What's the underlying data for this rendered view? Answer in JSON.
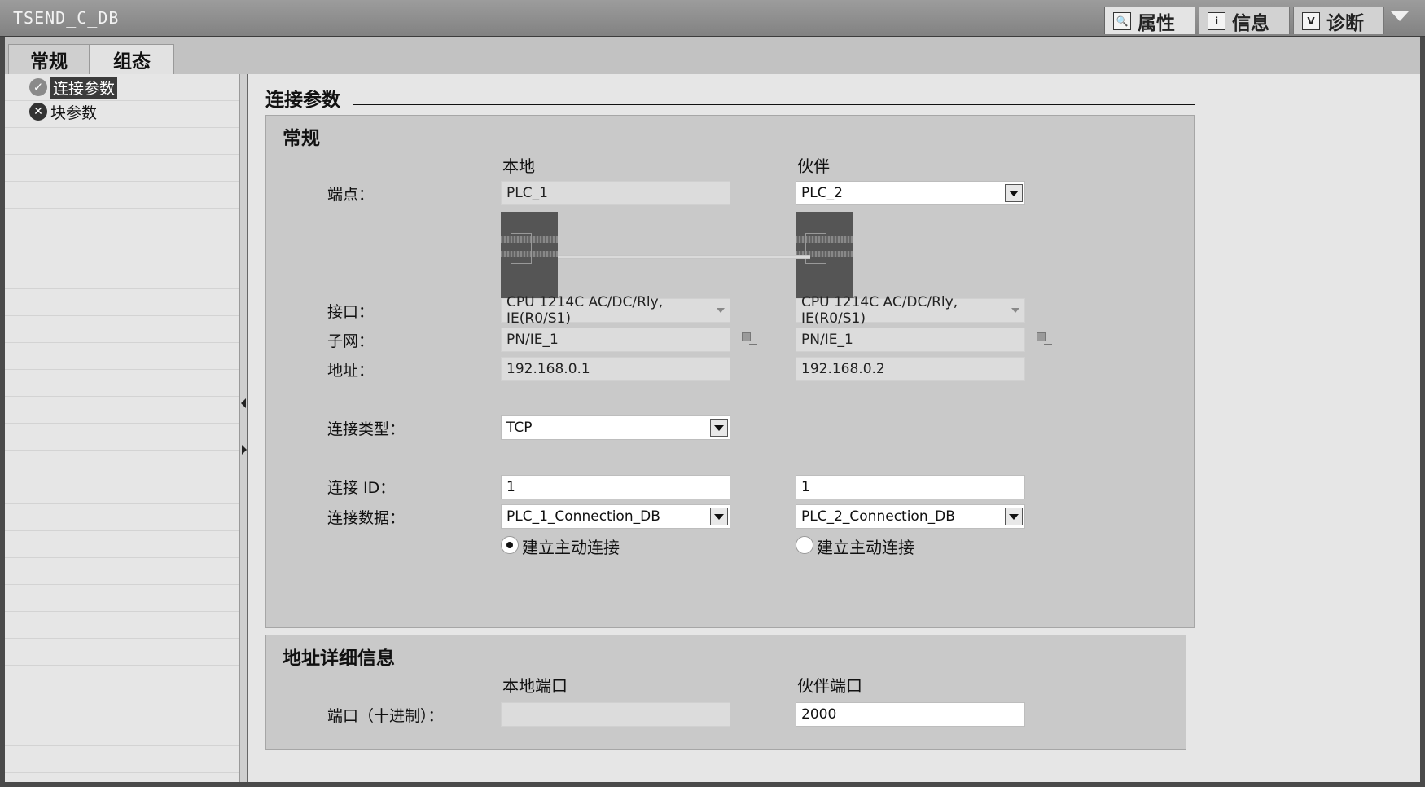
{
  "window": {
    "title": "TSEND_C_DB",
    "tabs": [
      {
        "label": "属性",
        "icon": "properties-icon"
      },
      {
        "label": "信息",
        "icon": "info-icon"
      },
      {
        "label": "诊断",
        "icon": "diagnostics-icon"
      }
    ]
  },
  "subtabs": [
    "常规",
    "组态"
  ],
  "nav": {
    "items": [
      {
        "label": "连接参数",
        "status": "ok"
      },
      {
        "label": "块参数",
        "status": "error"
      }
    ]
  },
  "section": {
    "title": "连接参数",
    "general": {
      "title": "常规",
      "col_local": "本地",
      "col_partner": "伙伴",
      "labels": {
        "endpoint": "端点：",
        "interface": "接口：",
        "subnet": "子网：",
        "address": "地址：",
        "conn_type": "连接类型：",
        "conn_id": "连接 ID：",
        "conn_data": "连接数据："
      },
      "local": {
        "endpoint": "PLC_1",
        "interface": "CPU 1214C AC/DC/Rly, IE(R0/S1)",
        "subnet": "PN/IE_1",
        "address": "192.168.0.1",
        "conn_type": "TCP",
        "conn_id": "1",
        "conn_data": "PLC_1_Connection_DB",
        "active_label": "建立主动连接",
        "active_checked": true
      },
      "partner": {
        "endpoint": "PLC_2",
        "interface": "CPU 1214C AC/DC/Rly, IE(R0/S1)",
        "subnet": "PN/IE_1",
        "address": "192.168.0.2",
        "conn_id": "1",
        "conn_data": "PLC_2_Connection_DB",
        "active_label": "建立主动连接",
        "active_checked": false
      }
    },
    "address_details": {
      "title": "地址详细信息",
      "col_local": "本地端口",
      "col_partner": "伙伴端口",
      "port_label": "端口（十进制）：",
      "local_port": "",
      "partner_port": "2000"
    }
  }
}
